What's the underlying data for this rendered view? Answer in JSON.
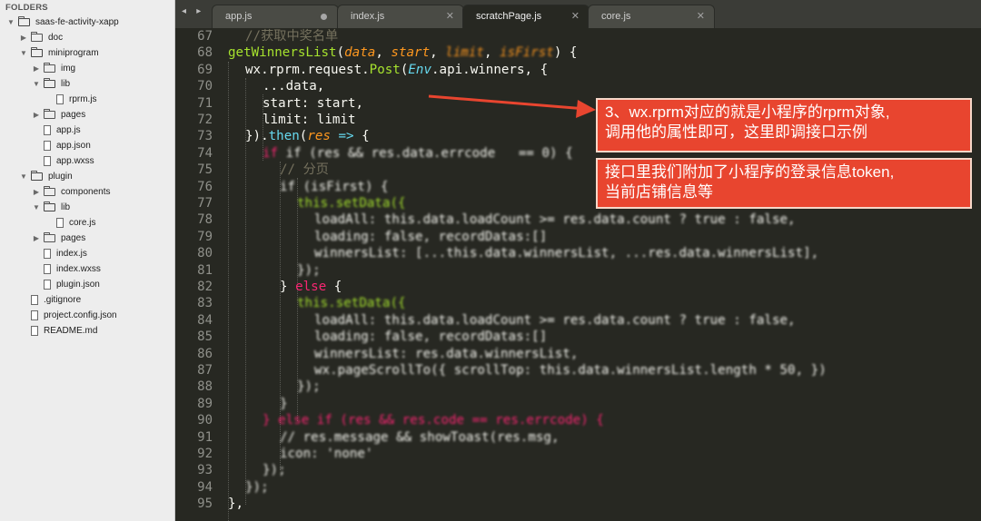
{
  "sidebar": {
    "header": "FOLDERS",
    "tree": [
      {
        "label": "saas-fe-activity-xapp",
        "kind": "folder",
        "open": true,
        "depth": 0
      },
      {
        "label": "doc",
        "kind": "folder",
        "open": false,
        "depth": 1
      },
      {
        "label": "miniprogram",
        "kind": "folder",
        "open": true,
        "depth": 1
      },
      {
        "label": "img",
        "kind": "folder",
        "open": false,
        "depth": 2
      },
      {
        "label": "lib",
        "kind": "folder",
        "open": true,
        "depth": 2
      },
      {
        "label": "rprm.js",
        "kind": "file",
        "depth": 3
      },
      {
        "label": "pages",
        "kind": "folder",
        "open": false,
        "depth": 2
      },
      {
        "label": "app.js",
        "kind": "file",
        "depth": 2
      },
      {
        "label": "app.json",
        "kind": "file",
        "depth": 2
      },
      {
        "label": "app.wxss",
        "kind": "file",
        "depth": 2
      },
      {
        "label": "plugin",
        "kind": "folder",
        "open": true,
        "depth": 1
      },
      {
        "label": "components",
        "kind": "folder",
        "open": false,
        "depth": 2
      },
      {
        "label": "lib",
        "kind": "folder",
        "open": true,
        "depth": 2
      },
      {
        "label": "core.js",
        "kind": "file",
        "depth": 3
      },
      {
        "label": "pages",
        "kind": "folder",
        "open": false,
        "depth": 2
      },
      {
        "label": "index.js",
        "kind": "file",
        "depth": 2
      },
      {
        "label": "index.wxss",
        "kind": "file",
        "depth": 2
      },
      {
        "label": "plugin.json",
        "kind": "file",
        "depth": 2
      },
      {
        "label": ".gitignore",
        "kind": "file",
        "depth": 1
      },
      {
        "label": "project.config.json",
        "kind": "file",
        "depth": 1
      },
      {
        "label": "README.md",
        "kind": "file",
        "depth": 1
      }
    ]
  },
  "tabbar": {
    "nav": "◂ ▸",
    "tabs": [
      {
        "label": "app.js",
        "state": "dirty"
      },
      {
        "label": "index.js",
        "state": "close"
      },
      {
        "label": "scratchPage.js",
        "state": "active"
      },
      {
        "label": "core.js",
        "state": "close"
      }
    ],
    "close_glyph": "✕"
  },
  "editor": {
    "line_numbers": [
      "67",
      "68",
      "69",
      "70",
      "71",
      "72",
      "73",
      "74",
      "75",
      "76",
      "77",
      "78",
      "79",
      "80",
      "81",
      "82",
      "83",
      "84",
      "85",
      "86",
      "87",
      "88",
      "89",
      "90",
      "91",
      "92",
      "93",
      "94",
      "95"
    ],
    "lines": {
      "l67": "//获取中奖名单",
      "l68_fn": "getWinnersList",
      "l68_p1": "data",
      "l68_p2": "start",
      "l68_p3": "limit",
      "l68_p4": "isFirst",
      "l69_a": "wx.rprm.request.",
      "l69_b": "Post",
      "l69_c": "Env",
      "l69_d": ".api.winners, {",
      "l70": "...data,",
      "l71": "start: start,",
      "l72": "limit: limit",
      "l73_a": "}).",
      "l73_b": "then",
      "l73_c": "res",
      "l73_d": "=>",
      "l73_e": "{",
      "l74": "if (res && res.data.errcode   == 0) {",
      "l75": "// 分页",
      "l76": "if (isFirst) {",
      "l77": "this.setData({",
      "l78": "loadAll: this.data.loadCount >= res.data.count ? true : false,",
      "l79": "loading: false, recordDatas:[]",
      "l80": "winnersList: [...this.data.winnersList, ...res.data.winnersList],",
      "l81": "});",
      "l82_a": "} ",
      "l82_b": "else",
      "l82_c": " {",
      "l83": "this.setData({",
      "l84": "loadAll: this.data.loadCount >= res.data.count ? true : false,",
      "l85": "loading: false, recordDatas:[]",
      "l86": "winnersList: res.data.winnersList,",
      "l87": "wx.pageScrollTo({ scrollTop: this.data.winnersList.length * 50, })",
      "l88": "});",
      "l89": "}",
      "l90": "} else if (res && res.code == res.errcode) {",
      "l91": "// res.message && showToast(res.msg,",
      "l92": "icon: 'none'",
      "l93": "});",
      "l94": "});",
      "l95": "},"
    }
  },
  "annotations": {
    "callout1": "3、wx.rprm对应的就是小程序的rprm对象,\n调用他的属性即可，这里即调接口示例",
    "callout2": "接口里我们附加了小程序的登录信息token,\n当前店铺信息等"
  },
  "colors": {
    "editor_bg": "#272822",
    "callout_bg": "#e8452f",
    "keyword": "#f92672",
    "function": "#a6e22e",
    "param": "#fd971f",
    "type": "#66d9ef",
    "comment": "#75715e"
  }
}
